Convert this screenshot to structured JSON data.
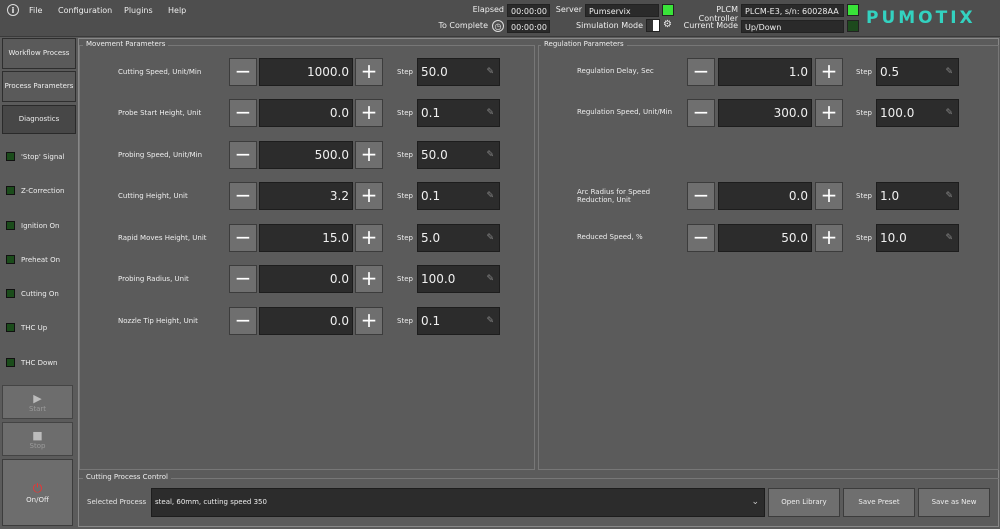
{
  "menu": [
    "File",
    "Configuration",
    "Plugins",
    "Help"
  ],
  "status": {
    "elapsed_label": "Elapsed",
    "elapsed_value": "00:00:00",
    "to_complete_label": "To Complete",
    "to_complete_value": "00:00:00",
    "server_label": "Server",
    "server_value": "Pumservix",
    "simulation_label": "Simulation Mode",
    "plcm_label": "PLCM Controller",
    "plcm_value": "PLCM-E3, s/n: 60028AA",
    "mode_label": "Current Mode",
    "mode_value": "Up/Down"
  },
  "logo": "PUMOTIX",
  "nav": [
    "Workflow Process",
    "Process Parameters",
    "Diagnostics"
  ],
  "indicators": [
    "'Stop' Signal",
    "Z-Correction",
    "Ignition On",
    "Preheat On",
    "Cutting On",
    "THC Up",
    "THC Down"
  ],
  "controls": {
    "start": "Start",
    "stop": "Stop",
    "onoff": "On/Off"
  },
  "movement": {
    "title": "Movement Parameters",
    "rows": [
      {
        "label": "Cutting Speed, Unit/Min",
        "value": "1000.0",
        "step": "50.0"
      },
      {
        "label": "Probe Start Height, Unit",
        "value": "0.0",
        "step": "0.1"
      },
      {
        "label": "Probing Speed, Unit/Min",
        "value": "500.0",
        "step": "50.0"
      },
      {
        "label": "Cutting Height, Unit",
        "value": "3.2",
        "step": "0.1"
      },
      {
        "label": "Rapid Moves Height, Unit",
        "value": "15.0",
        "step": "5.0"
      },
      {
        "label": "Probing Radius, Unit",
        "value": "0.0",
        "step": "100.0"
      },
      {
        "label": "Nozzle Tip Height, Unit",
        "value": "0.0",
        "step": "0.1"
      }
    ]
  },
  "regulation": {
    "title": "Regulation Parameters",
    "rows": [
      {
        "label": "Regulation Delay, Sec",
        "value": "1.0",
        "step": "0.5"
      },
      {
        "label": "Regulation Speed, Unit/Min",
        "value": "300.0",
        "step": "100.0"
      },
      {
        "label": "Arc Radius for Speed Reduction, Unit",
        "value": "0.0",
        "step": "1.0"
      },
      {
        "label": "Reduced Speed, %",
        "value": "50.0",
        "step": "10.0"
      }
    ]
  },
  "step_label": "Step",
  "process": {
    "title": "Cutting Process Control",
    "selected_label": "Selected Process",
    "selected_value": "steal, 60mm, cutting speed 350",
    "open_library": "Open Library",
    "save_preset": "Save Preset",
    "save_as_new": "Save as New"
  }
}
